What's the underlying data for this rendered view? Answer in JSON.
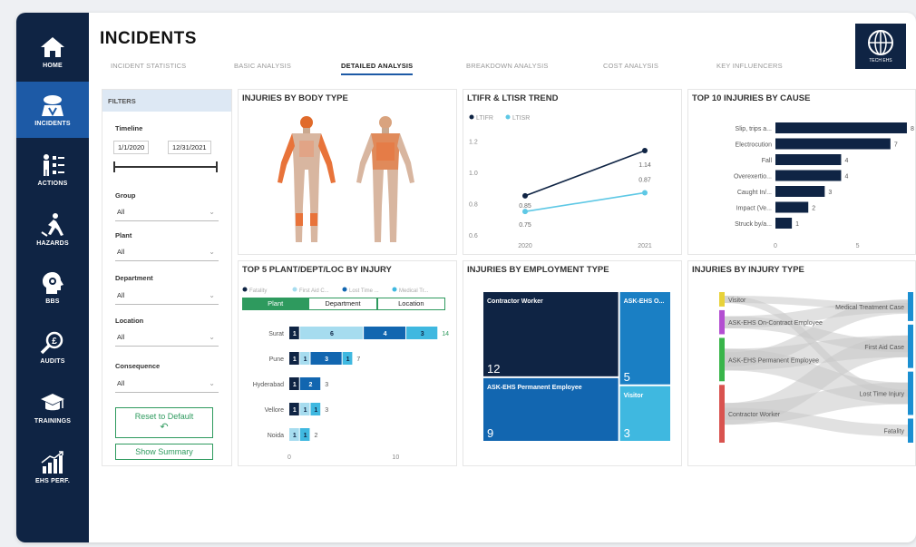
{
  "nav": [
    {
      "label": "HOME",
      "icon": "home-icon"
    },
    {
      "label": "INCIDENTS",
      "icon": "incidents-icon"
    },
    {
      "label": "ACTIONS",
      "icon": "actions-icon"
    },
    {
      "label": "HAZARDS",
      "icon": "hazards-icon"
    },
    {
      "label": "BBS",
      "icon": "bbs-icon"
    },
    {
      "label": "AUDITS",
      "icon": "audits-icon"
    },
    {
      "label": "TRAININGS",
      "icon": "trainings-icon"
    },
    {
      "label": "EHS PERF.",
      "icon": "ehs-perf-icon"
    }
  ],
  "title": "INCIDENTS",
  "logo_text": "TECH EHS",
  "tabs": [
    "INCIDENT STATISTICS",
    "BASIC ANALYSIS",
    "DETAILED ANALYSIS",
    "BREAKDOWN ANALYSIS",
    "COST ANALYSIS",
    "KEY INFLUENCERS"
  ],
  "active_tab": "DETAILED ANALYSIS",
  "filters": {
    "header": "FILTERS",
    "timeline_label": "Timeline",
    "date_from": "1/1/2020",
    "date_to": "12/31/2021",
    "group_label": "Group",
    "group_value": "All",
    "plant_label": "Plant",
    "plant_value": "All",
    "department_label": "Department",
    "department_value": "All",
    "location_label": "Location",
    "location_value": "All",
    "consequence_label": "Consequence",
    "consequence_value": "All",
    "reset_label": "Reset to Default",
    "summary_label": "Show Summary"
  },
  "body_card": {
    "title": "INJURIES BY BODY TYPE"
  },
  "trend_card": {
    "title": "LTIFR & LTISR TREND"
  },
  "cause_card": {
    "title": "TOP 10 INJURIES BY CAUSE"
  },
  "plant_card": {
    "title": "TOP 5 PLANT/DEPT/LOC BY INJURY",
    "toggles": [
      "Plant",
      "Department",
      "Location"
    ]
  },
  "employment_card": {
    "title": "INJURIES BY EMPLOYMENT TYPE"
  },
  "injurytype_card": {
    "title": "INJURIES BY INJURY TYPE"
  },
  "colors": {
    "nav": "#0f2444",
    "accent": "#1d5aa6",
    "green": "#2e9a5e",
    "navy": "#0f2444",
    "c1": "#0f2444",
    "c2": "#a6dcef",
    "c3": "#1266b0",
    "c4": "#3fb8e0"
  },
  "chart_data": [
    {
      "type": "line",
      "title": "LTIFR & LTISR TREND",
      "x": [
        "2020",
        "2021"
      ],
      "series": [
        {
          "name": "LTIFR",
          "values": [
            0.85,
            1.14
          ],
          "color": "#0f2444"
        },
        {
          "name": "LTISR",
          "values": [
            0.75,
            0.87
          ],
          "color": "#5ec8e5"
        }
      ],
      "point_labels": [
        "0.85",
        "0.75",
        "1.14",
        "0.87"
      ],
      "yticks": [
        "1.2",
        "1.0",
        "0.8",
        "0.6"
      ],
      "ylim": [
        0.6,
        1.25
      ]
    },
    {
      "type": "bar",
      "title": "TOP 10 INJURIES BY CAUSE",
      "categories": [
        "Slip, trips a...",
        "Electrocution",
        "Fall",
        "Overexertio...",
        "Caught In/...",
        "Impact (Ve...",
        "Struck by/a..."
      ],
      "values": [
        8,
        7,
        4,
        4,
        3,
        2,
        1
      ],
      "xticks": [
        "0",
        "5"
      ],
      "xlim": [
        0,
        8.5
      ]
    },
    {
      "type": "bar",
      "title": "TOP 5 PLANT/DEPT/LOC BY INJURY",
      "legend": [
        "Fatality",
        "First Aid C...",
        "Lost Time ...",
        "Medical Tr..."
      ],
      "categories": [
        "Surat",
        "Pune",
        "Hyderabad",
        "Vellore",
        "Noida"
      ],
      "series": [
        {
          "name": "Fatality",
          "values": [
            1,
            1,
            1,
            1,
            0
          ],
          "color": "#0f2444"
        },
        {
          "name": "First Aid C...",
          "values": [
            6,
            1,
            0,
            1,
            1
          ],
          "color": "#a6dcef"
        },
        {
          "name": "Lost Time ...",
          "values": [
            4,
            3,
            2,
            0,
            0
          ],
          "color": "#1266b0"
        },
        {
          "name": "Medical Tr...",
          "values": [
            3,
            1,
            0,
            1,
            1
          ],
          "color": "#3fb8e0"
        }
      ],
      "totals": [
        "14",
        "7",
        "3",
        "3",
        "2"
      ],
      "xticks": [
        "0",
        "10"
      ],
      "xmax": 15
    },
    {
      "type": "treemap",
      "title": "INJURIES BY EMPLOYMENT TYPE",
      "items": [
        {
          "name": "Contractor Worker",
          "value": 12,
          "color": "#0f2444"
        },
        {
          "name": "ASK-EHS O...",
          "value": 5,
          "color": "#1a7fc4"
        },
        {
          "name": "ASK-EHS Permanent Employee",
          "value": 9,
          "color": "#1266b0"
        },
        {
          "name": "Visitor",
          "value": 3,
          "color": "#3fb8e0"
        }
      ]
    },
    {
      "type": "sankey",
      "title": "INJURIES BY INJURY TYPE",
      "sources": [
        {
          "name": "Visitor",
          "value": 3,
          "color": "#e8d23a"
        },
        {
          "name": "ASK-EHS On-Contract Employee",
          "value": 5,
          "color": "#b34fd1"
        },
        {
          "name": "ASK-EHS Permanent Employee",
          "value": 9,
          "color": "#39b54a"
        },
        {
          "name": "Contractor Worker",
          "value": 12,
          "color": "#d9534f"
        }
      ],
      "targets": [
        {
          "name": "Medical Treatment Case",
          "value": 6
        },
        {
          "name": "First Aid Case",
          "value": 9
        },
        {
          "name": "Lost Time Injury",
          "value": 9
        },
        {
          "name": "Fatality",
          "value": 5
        }
      ]
    }
  ]
}
